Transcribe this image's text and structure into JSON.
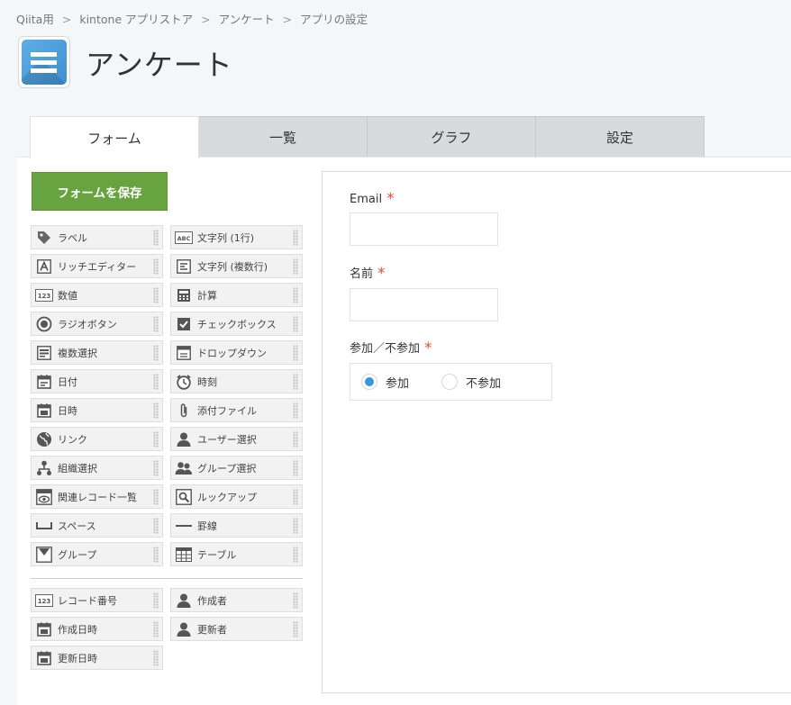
{
  "breadcrumb": [
    "Qiita用",
    "kintone アプリストア",
    "アンケート",
    "アプリの設定"
  ],
  "app": {
    "title": "アンケート"
  },
  "tabs": [
    {
      "label": "フォーム",
      "active": true
    },
    {
      "label": "一覧",
      "active": false
    },
    {
      "label": "グラフ",
      "active": false
    },
    {
      "label": "設定",
      "active": false
    }
  ],
  "save_button": "フォームを保存",
  "palette": [
    {
      "label": "ラベル",
      "icon": "tag-icon"
    },
    {
      "label": "文字列 (1行)",
      "icon": "abc-icon"
    },
    {
      "label": "リッチエディター",
      "icon": "rich-editor-icon"
    },
    {
      "label": "文字列 (複数行)",
      "icon": "multiline-text-icon"
    },
    {
      "label": "数値",
      "icon": "number-icon"
    },
    {
      "label": "計算",
      "icon": "calculator-icon"
    },
    {
      "label": "ラジオボタン",
      "icon": "radio-icon"
    },
    {
      "label": "チェックボックス",
      "icon": "checkbox-icon"
    },
    {
      "label": "複数選択",
      "icon": "multi-select-icon"
    },
    {
      "label": "ドロップダウン",
      "icon": "dropdown-icon"
    },
    {
      "label": "日付",
      "icon": "date-icon"
    },
    {
      "label": "時刻",
      "icon": "clock-icon"
    },
    {
      "label": "日時",
      "icon": "datetime-icon"
    },
    {
      "label": "添付ファイル",
      "icon": "paperclip-icon"
    },
    {
      "label": "リンク",
      "icon": "globe-icon"
    },
    {
      "label": "ユーザー選択",
      "icon": "user-icon"
    },
    {
      "label": "組織選択",
      "icon": "org-icon"
    },
    {
      "label": "グループ選択",
      "icon": "group-icon"
    },
    {
      "label": "関連レコード一覧",
      "icon": "related-records-icon"
    },
    {
      "label": "ルックアップ",
      "icon": "lookup-icon"
    },
    {
      "label": "スペース",
      "icon": "space-icon"
    },
    {
      "label": "罫線",
      "icon": "line-icon"
    },
    {
      "label": "グループ",
      "icon": "group-field-icon"
    },
    {
      "label": "テーブル",
      "icon": "table-icon"
    }
  ],
  "system_palette": [
    {
      "label": "レコード番号",
      "icon": "number-icon"
    },
    {
      "label": "作成者",
      "icon": "user-icon"
    },
    {
      "label": "作成日時",
      "icon": "datetime-icon"
    },
    {
      "label": "更新者",
      "icon": "user-icon"
    },
    {
      "label": "更新日時",
      "icon": "datetime-icon"
    }
  ],
  "form": {
    "email_label": "Email",
    "name_label": "名前",
    "attend_label": "参加／不参加",
    "required_mark": "*",
    "options": [
      {
        "label": "参加",
        "selected": true
      },
      {
        "label": "不参加",
        "selected": false
      }
    ]
  },
  "colors": {
    "save_button": "#67a33e",
    "required": "#e74c3c",
    "radio_selected": "#3498db"
  }
}
